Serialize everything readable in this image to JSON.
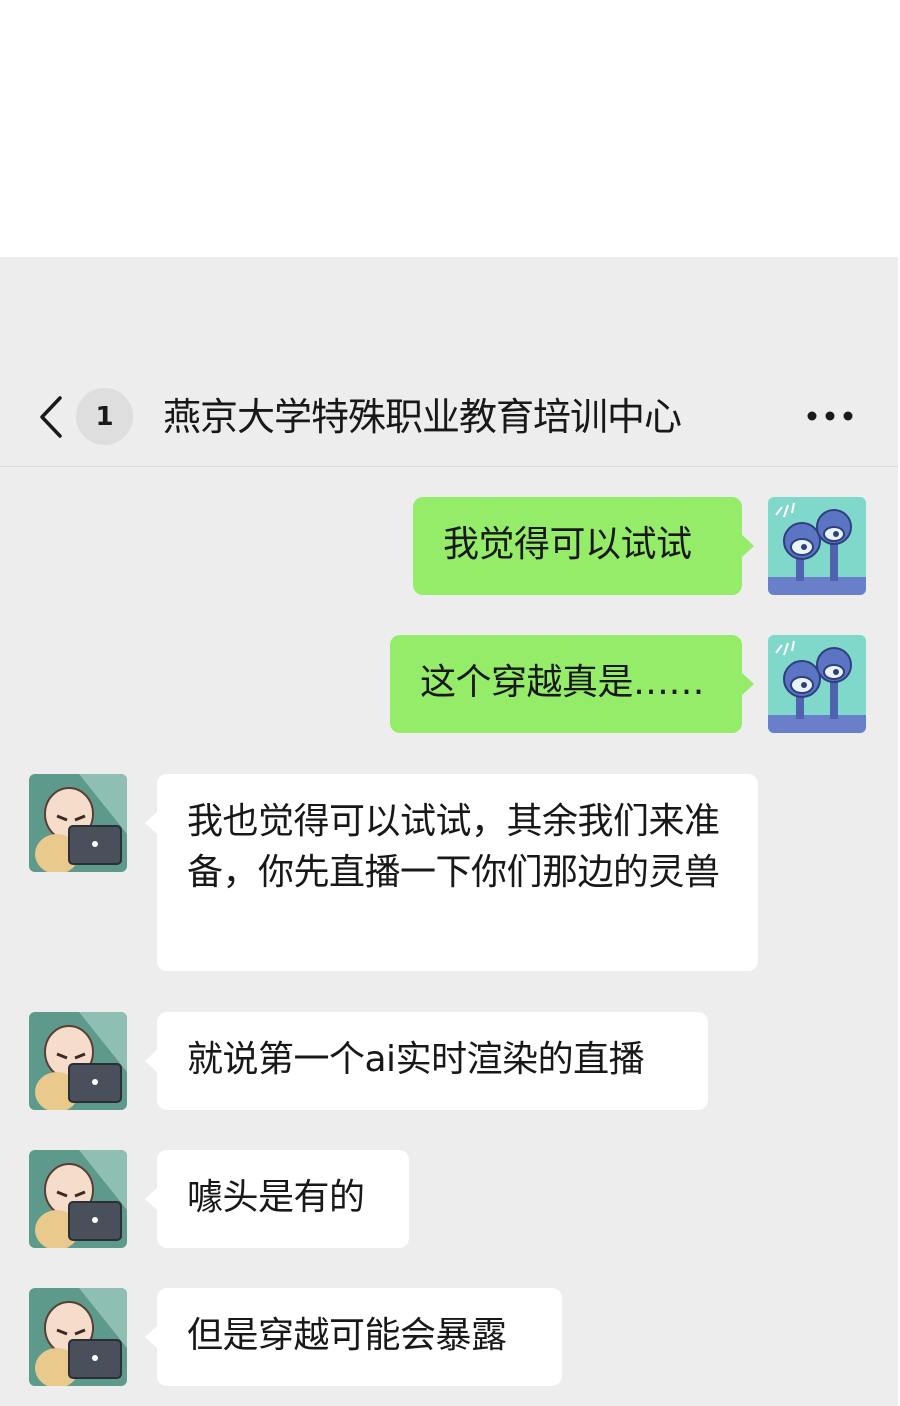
{
  "header": {
    "unread_count": "1",
    "title": "燕京大学特殊职业教育培训中心"
  },
  "icons": {
    "back": "chevron-left-icon",
    "more": "more-dots-icon"
  },
  "colors": {
    "sent_bubble": "#95ec69",
    "received_bubble": "#ffffff",
    "chat_background": "#ededed"
  },
  "messages": [
    {
      "direction": "sent",
      "text": "我觉得可以试试"
    },
    {
      "direction": "sent",
      "text": "这个穿越真是……"
    },
    {
      "direction": "received",
      "text": "我也觉得可以试试，其余我们来准备，你先直播一下你们那边的灵兽"
    },
    {
      "direction": "received",
      "text": "就说第一个ai实时渲染的直播"
    },
    {
      "direction": "received",
      "text": "噱头是有的"
    },
    {
      "direction": "received",
      "text": "但是穿越可能会暴露"
    }
  ]
}
